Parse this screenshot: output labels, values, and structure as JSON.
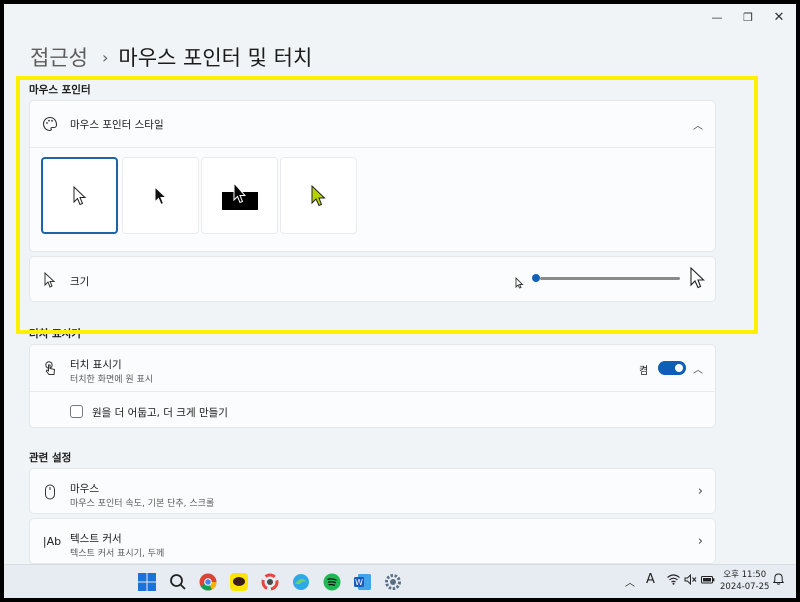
{
  "window": {
    "minimize": "—",
    "maximize": "❐",
    "close": "✕"
  },
  "breadcrumb": {
    "parent": "접근성",
    "separator": "›",
    "current": "마우스 포인터 및 터치"
  },
  "mouse_pointer": {
    "section_title": "마우스 포인터",
    "style_label": "마우스 포인터 스타일",
    "styles": [
      {
        "name": "white",
        "selected": true
      },
      {
        "name": "black",
        "selected": false
      },
      {
        "name": "inverted",
        "selected": false
      },
      {
        "name": "custom",
        "color": "#b5d200",
        "selected": false
      }
    ],
    "size_label": "크기",
    "size_level": 0.0
  },
  "touch": {
    "section_title": "터치 표시기",
    "indicator_label": "터치 표시기",
    "indicator_sub": "터치한 화면에 원 표시",
    "toggle_state": "켬",
    "checkbox_label": "원을 더 어둡고, 더 크게 만들기"
  },
  "related": {
    "section_title": "관련 설정",
    "items": [
      {
        "label": "마우스",
        "sub": "마우스 포인터 속도, 기본 단추, 스크롤"
      },
      {
        "label": "텍스트 커서",
        "sub": "텍스트 커서 표시기, 두께"
      }
    ]
  },
  "taskbar": {
    "apps": [
      "windows-start",
      "search",
      "chrome",
      "kakaotalk",
      "photos",
      "edge-like",
      "spotify",
      "word",
      "settings"
    ],
    "clock_time": "오후 11:50",
    "clock_date": "2024-07-25",
    "tray_font": "A"
  },
  "colors": {
    "accent": "#0f5fb8",
    "highlight": "#fdf000",
    "custom_pointer": "#b5d200"
  }
}
